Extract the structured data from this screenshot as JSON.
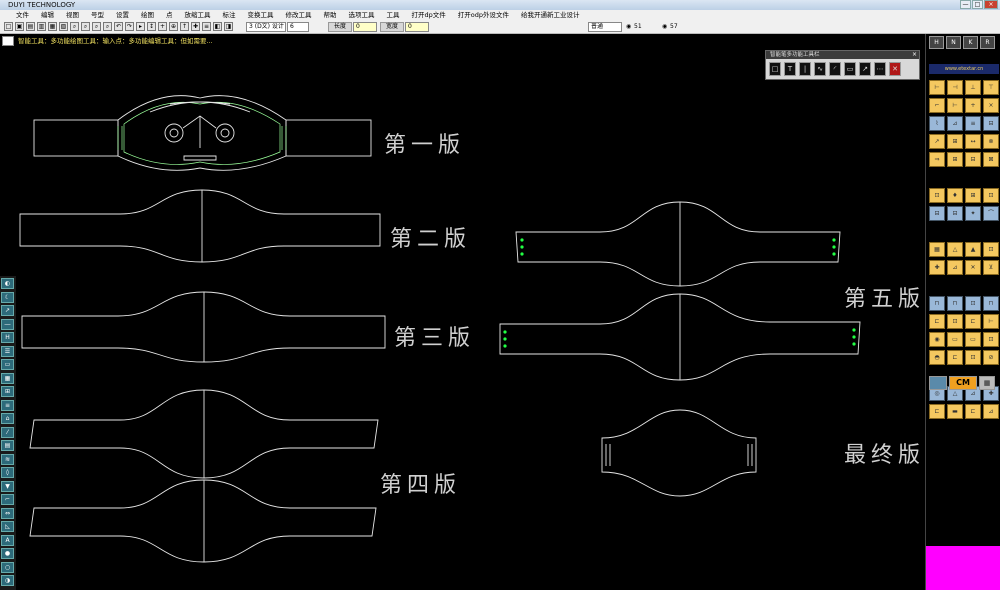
{
  "app": {
    "title": "DUYI TECHNOLOGY",
    "window_controls": [
      "—",
      "□",
      "×"
    ]
  },
  "menu": {
    "items": [
      "文件",
      "编辑",
      "视图",
      "号型",
      "设置",
      "绘图",
      "点",
      "放缩工具",
      "标注",
      "变换工具",
      "修改工具",
      "帮助",
      "选项工具",
      "工具",
      "打开dp文件",
      "打开odp外设文件",
      "给我开通新工业设计"
    ]
  },
  "toolbar": {
    "icons": [
      "□",
      "▣",
      "▤",
      "▥",
      "▦",
      "▧",
      "⌕",
      "⌕",
      "⌕",
      "⌕",
      "↶",
      "↷",
      "▸",
      "↕",
      "+",
      "⊕",
      "↑",
      "✚",
      "≡",
      "◧",
      "◨",
      "⊞"
    ],
    "field_size": "6",
    "field_layer": "3 (D文) 设计",
    "label_length": "长度",
    "field_length": "0",
    "label_width": "宽度",
    "field_width": "0",
    "field_mode": "普通",
    "count_a": "51",
    "count_b": "57"
  },
  "hint": {
    "text": "智能工具：多功能绘图工具：输入点：多功能编辑工具：但如需要..."
  },
  "canvas": {
    "labels": {
      "v1": "第一版",
      "v2": "第二版",
      "v3": "第三版",
      "v4": "第四版",
      "v5": "第五版",
      "final": "最终版"
    }
  },
  "palette": {
    "title": "智能笔多功能工具栏",
    "close": "×",
    "buttons": [
      "□",
      "T",
      "|",
      "∿",
      "◜",
      "▭",
      "↗",
      "⋯",
      "✕"
    ]
  },
  "left_tools": {
    "icons": [
      "◐",
      "☾",
      "↗",
      "―",
      "H",
      "☰",
      "▭",
      "▦",
      "⊞",
      "≡",
      "⌂",
      "⁄",
      "▤",
      "≋",
      "◊",
      "▼",
      "⌐",
      "⇔",
      "◺",
      "A",
      "●",
      "○",
      "◑"
    ]
  },
  "right_panel": {
    "top": [
      "H",
      "N",
      "K",
      "R"
    ],
    "banner": "www.etextar.cn",
    "tools": [
      "⊢",
      "⊣",
      "⊥",
      "⊤",
      "⌐",
      "⊢",
      "+",
      "×",
      "⌇",
      "⊿",
      "≡",
      "⊟",
      "↗",
      "⊞",
      "↔",
      "⊗",
      "⇒",
      "⊞",
      "⊟",
      "⊠",
      "",
      "",
      "",
      "",
      "⊡",
      "♦",
      "⊞",
      "⊡",
      "⊟",
      "⊟",
      "✦",
      "⌒",
      "",
      "",
      "",
      "",
      "▦",
      "△",
      "▲",
      "⊡",
      "✚",
      "⊿",
      "✕",
      "⊻",
      "",
      "",
      "",
      "",
      "⊓",
      "⊓",
      "⊡",
      "⊓",
      "⊏",
      "⊡",
      "⊏",
      "⊢",
      "◉",
      "▭",
      "▭",
      "⊡",
      "◓",
      "⊏",
      "⊡",
      "⊘",
      "",
      "",
      "",
      "",
      "◎",
      "△",
      "⊿",
      "✚",
      "⊏",
      "▬",
      "⊏",
      "⊿"
    ],
    "unit": "CM",
    "calc": "▦"
  }
}
